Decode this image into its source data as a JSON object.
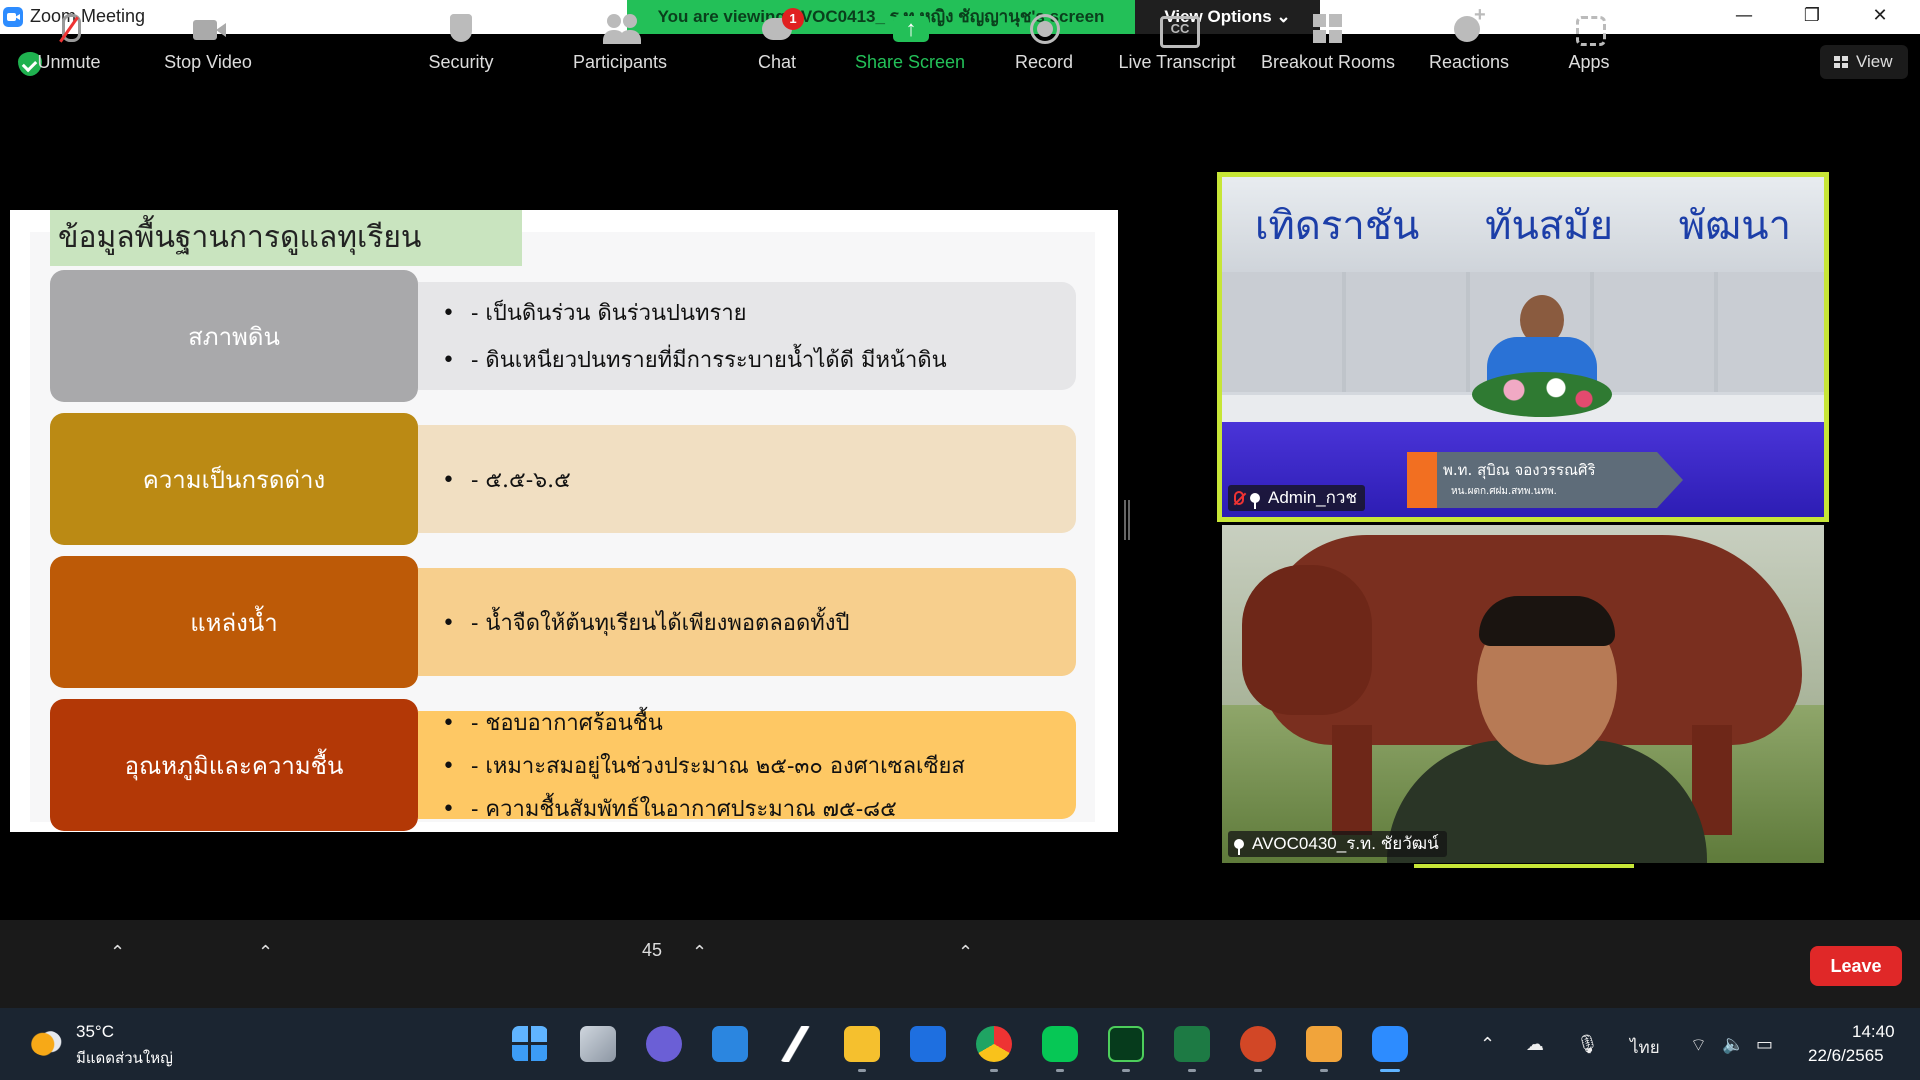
{
  "window": {
    "title": "Zoom Meeting",
    "viewing_banner": "You are viewing AVOC0413_ ร.ท.หญิง ชัญญานุช's screen",
    "view_options_label": "View Options ⌄",
    "minimize": "—",
    "restore": "❐",
    "close": "✕"
  },
  "meeting": {
    "view_label": "View"
  },
  "slide": {
    "title": "ข้อมูลพื้นฐานการดูแลทุเรียน",
    "rows": [
      {
        "label": "สภาพดิน",
        "lines": [
          "- เป็นดินร่วน ดินร่วนปนทราย",
          "- ดินเหนียวปนทรายที่มีการระบายน้ำได้ดี มีหน้าดิน"
        ]
      },
      {
        "label": "ความเป็นกรดด่าง",
        "lines": [
          "- ๕.๕-๖.๕"
        ]
      },
      {
        "label": "แหล่งน้ำ",
        "lines": [
          "- น้ำจืดให้ต้นทุเรียนได้เพียงพอตลอดทั้งปี"
        ]
      },
      {
        "label": "อุณหภูมิและความชื้น",
        "lines": [
          "- ชอบอากาศร้อนชื้น",
          "- เหมาะสมอยู่ในช่วงประมาณ ๒๕-๓๐ องศาเซลเซียส",
          "- ความชื้นสัมพัทธ์ในอากาศประมาณ ๗๕-๘๕"
        ]
      }
    ],
    "colors": {
      "title_bg": "#c9e4bf",
      "row_labels": [
        "#a9a9ab",
        "#bb8a14",
        "#bd5a07",
        "#b33806"
      ],
      "row_bodies": [
        "#e6e6e8",
        "#f1dfc2",
        "#f7cf8d",
        "#fec864"
      ]
    }
  },
  "videos": {
    "top": {
      "banner_words": [
        "เทิดราชัน",
        "ทันสมัย",
        "พัฒนา"
      ],
      "name_plate_line1": "พ.ท. สุบิณ  จองวรรณศิริ",
      "name_plate_line2": "หน.ผตก.ศฝม.สทพ.นทพ.",
      "participant_name": "Admin_กวช"
    },
    "bottom": {
      "participant_name": "AVOC0430_ร.ท. ชัยวัฒน์"
    }
  },
  "toolbar": {
    "unmute": "Unmute",
    "stop_video": "Stop Video",
    "security": "Security",
    "participants": "Participants",
    "participants_count": "45",
    "chat": "Chat",
    "chat_badge": "1",
    "share_screen": "Share Screen",
    "record": "Record",
    "live_transcript": "Live Transcript",
    "breakout_rooms": "Breakout Rooms",
    "reactions": "Reactions",
    "apps": "Apps",
    "leave": "Leave",
    "caret": "⌃"
  },
  "taskbar": {
    "weather_temp": "35°C",
    "weather_desc": "มีแดดส่วนใหญ่",
    "language": "ไทย",
    "time": "14:40",
    "date": "22/6/2565",
    "apps": [
      "start-menu",
      "task-view",
      "teams-chat",
      "mail",
      "file-explorer-lightning",
      "folder",
      "dropbox",
      "chrome",
      "line",
      "dreamweaver",
      "excel",
      "powerpoint",
      "media-player",
      "zoom"
    ]
  }
}
